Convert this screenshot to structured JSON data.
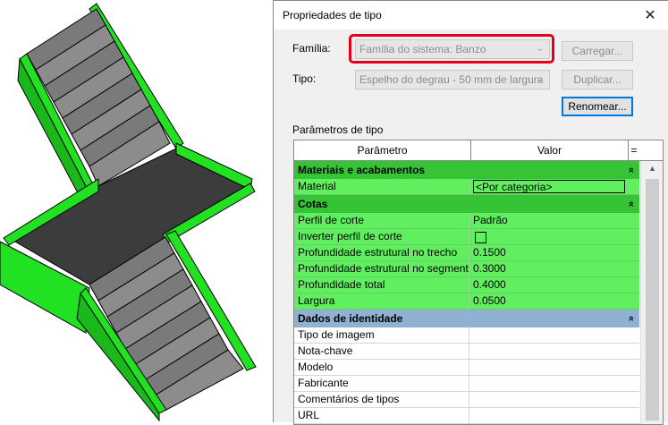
{
  "dialog": {
    "title": "Propriedades de tipo",
    "close_glyph": "✕",
    "family_label": "Família:",
    "family_value": "Família do sistema: Banzo",
    "type_label": "Tipo:",
    "type_value": "Espelho do degrau - 50 mm de largura",
    "load_button": "Carregar...",
    "duplicate_button": "Duplicar...",
    "rename_button": "Renomear...",
    "params_label": "Parâmetros de tipo"
  },
  "grid": {
    "col_param": "Parâmetro",
    "col_value": "Valor",
    "col_extra": "=",
    "sections": [
      {
        "title": "Materiais e acabamentos",
        "style": "green",
        "rows": [
          {
            "param": "Material",
            "value": "<Por categoria>"
          }
        ]
      },
      {
        "title": "Cotas",
        "style": "green",
        "rows": [
          {
            "param": "Perfil de corte",
            "value": "Padrão"
          },
          {
            "param": "Inverter perfil de corte",
            "value": ""
          },
          {
            "param": "Profundidade estrutural no trecho",
            "value": "0.1500"
          },
          {
            "param": "Profundidade estrutural no segment",
            "value": "0.3000"
          },
          {
            "param": "Profundidade total",
            "value": "0.4000"
          },
          {
            "param": "Largura",
            "value": "0.0500"
          }
        ]
      },
      {
        "title": "Dados de identidade",
        "style": "blue",
        "rows": [
          {
            "param": "Tipo de imagem",
            "value": ""
          },
          {
            "param": "Nota-chave",
            "value": ""
          },
          {
            "param": "Modelo",
            "value": ""
          },
          {
            "param": "Fabricante",
            "value": ""
          },
          {
            "param": "Comentários de tipos",
            "value": ""
          },
          {
            "param": "URL",
            "value": ""
          }
        ]
      }
    ]
  },
  "colors": {
    "highlight": "#e4001b",
    "section_green": "#36c436",
    "row_green": "#5fef5f",
    "section_blue": "#8fb2d3",
    "stair_green": "#22e022",
    "stair_landing": "#3c3c3c",
    "stair_tread": "#8a8a8a"
  }
}
